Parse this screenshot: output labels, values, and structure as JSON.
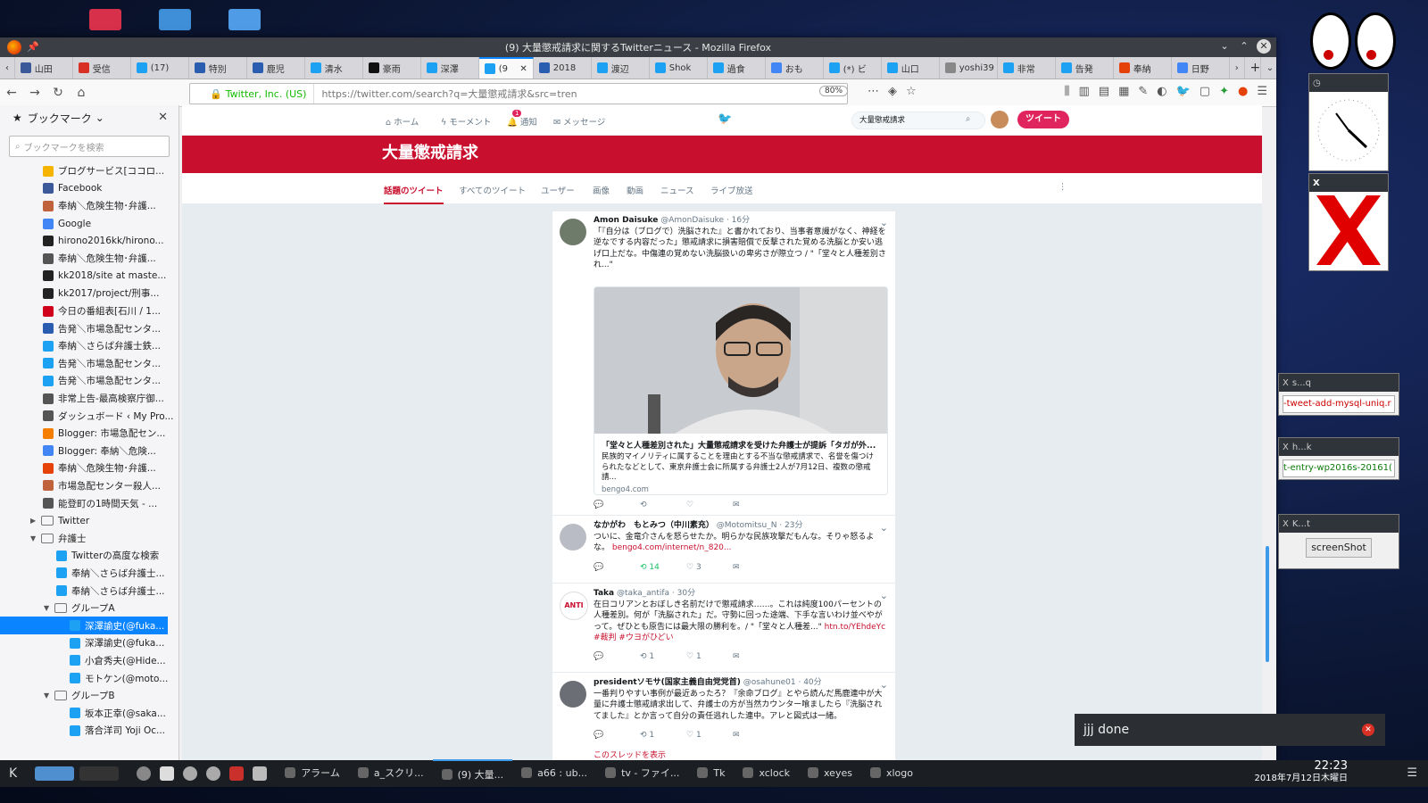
{
  "browser": {
    "window_title": "(9) 大量懲戒請求に関するTwitterニュース - Mozilla Firefox",
    "tabs": [
      {
        "label": "山田",
        "color": "#3b5998"
      },
      {
        "label": "受信",
        "color": "#d93025"
      },
      {
        "label": "(17)",
        "color": "#1da1f2"
      },
      {
        "label": "特別",
        "color": "#2a5db0"
      },
      {
        "label": "鹿児",
        "color": "#2a5db0"
      },
      {
        "label": "清水",
        "color": "#1da1f2"
      },
      {
        "label": "豪雨",
        "color": "#111111"
      },
      {
        "label": "深澤",
        "color": "#1da1f2"
      },
      {
        "label": "(9",
        "color": "#1da1f2",
        "active": true
      },
      {
        "label": "2018",
        "color": "#2a5db0"
      },
      {
        "label": "渡辺",
        "color": "#1da1f2"
      },
      {
        "label": "Shok",
        "color": "#1da1f2"
      },
      {
        "label": "過食",
        "color": "#1da1f2"
      },
      {
        "label": "おも",
        "color": "#4285f4"
      },
      {
        "label": "(*) ビ",
        "color": "#1da1f2"
      },
      {
        "label": "山口",
        "color": "#1da1f2"
      },
      {
        "label": "yoshi39",
        "color": "#888888"
      },
      {
        "label": "非常",
        "color": "#1da1f2"
      },
      {
        "label": "告発",
        "color": "#1da1f2"
      },
      {
        "label": "奉納",
        "color": "#e5420a"
      },
      {
        "label": "日野",
        "color": "#4285f4"
      }
    ],
    "url_identity": "Twitter, Inc. (US)",
    "url": "https://twitter.com/search?q=大量懲戒請求&src=tren",
    "zoom": "80%"
  },
  "sidebar": {
    "title": "ブックマーク",
    "search_placeholder": "ブックマークを検索",
    "items": [
      {
        "label": "ブログサービス[ココロ...",
        "color": "#f4b400",
        "indent": 0
      },
      {
        "label": "Facebook",
        "color": "#3b5998",
        "indent": 0
      },
      {
        "label": "奉納＼危険生物･弁護...",
        "color": "#c0623b",
        "indent": 0
      },
      {
        "label": "Google",
        "color": "#4285f4",
        "indent": 0
      },
      {
        "label": "hirono2016kk/hirono...",
        "color": "#222222",
        "indent": 0
      },
      {
        "label": "奉納＼危険生物･弁護...",
        "color": "#555555",
        "indent": 0
      },
      {
        "label": "kk2018/site at maste...",
        "color": "#222222",
        "indent": 0
      },
      {
        "label": "kk2017/project/刑事...",
        "color": "#222222",
        "indent": 0
      },
      {
        "label": "今日の番組表[石川 / 1...",
        "color": "#d0021b",
        "indent": 0
      },
      {
        "label": "告発＼市場急配センタ...",
        "color": "#2a5db0",
        "indent": 0
      },
      {
        "label": "奉納＼さらば弁護士鉄...",
        "color": "#1da1f2",
        "indent": 0
      },
      {
        "label": "告発＼市場急配センタ...",
        "color": "#1da1f2",
        "indent": 0
      },
      {
        "label": "告発＼市場急配センタ...",
        "color": "#1da1f2",
        "indent": 0
      },
      {
        "label": "非常上告-最高検察庁御...",
        "color": "#555555",
        "indent": 0
      },
      {
        "label": "ダッシュボード ‹ My Pro...",
        "color": "#555555",
        "indent": 0
      },
      {
        "label": "Blogger: 市場急配セン...",
        "color": "#f57d00",
        "indent": 0
      },
      {
        "label": "Blogger: 奉納＼危険...",
        "color": "#4285f4",
        "indent": 0
      },
      {
        "label": "奉納＼危険生物･弁護...",
        "color": "#e5420a",
        "indent": 0
      },
      {
        "label": "市場急配センター殺人...",
        "color": "#c0623b",
        "indent": 0
      },
      {
        "label": "能登町の1時間天気 - ...",
        "color": "#555555",
        "indent": 0
      },
      {
        "label": "Twitter",
        "color": "#888888",
        "indent": 0,
        "folder": true,
        "arrow": "▶"
      },
      {
        "label": "弁護士",
        "color": "#888888",
        "indent": 0,
        "folder": true,
        "arrow": "▼"
      },
      {
        "label": "Twitterの高度な検索",
        "color": "#1da1f2",
        "indent": 1
      },
      {
        "label": "奉納＼さらば弁護士...",
        "color": "#1da1f2",
        "indent": 1
      },
      {
        "label": "奉納＼さらば弁護士...",
        "color": "#1da1f2",
        "indent": 1
      },
      {
        "label": "グループA",
        "color": "#888888",
        "indent": 1,
        "folder": true,
        "arrow": "▼"
      },
      {
        "label": "深澤諭史(@fuka...",
        "color": "#1da1f2",
        "indent": 2,
        "selected": true
      },
      {
        "label": "深澤諭史(@fuka...",
        "color": "#1da1f2",
        "indent": 2
      },
      {
        "label": "小倉秀夫(@Hide...",
        "color": "#1da1f2",
        "indent": 2
      },
      {
        "label": "モトケン(@moto...",
        "color": "#1da1f2",
        "indent": 2
      },
      {
        "label": "グループB",
        "color": "#888888",
        "indent": 1,
        "folder": true,
        "arrow": "▼"
      },
      {
        "label": "坂本正幸(@saka...",
        "color": "#1da1f2",
        "indent": 2
      },
      {
        "label": "落合洋司 Yoji Oc...",
        "color": "#1da1f2",
        "indent": 2
      }
    ]
  },
  "twitter": {
    "nav": {
      "home": "ホーム",
      "moments": "モーメント",
      "notifications": "通知",
      "notifications_badge": "1",
      "messages": "メッセージ"
    },
    "search_value": "大量懲戒請求",
    "tweet_button": "ツイート",
    "banner_title": "大量懲戒請求",
    "tabs": [
      "話題のツイート",
      "すべてのツイート",
      "ユーザー",
      "画像",
      "動画",
      "ニュース",
      "ライブ放送"
    ],
    "active_tab": "話題のツイート",
    "tweets": [
      {
        "name": "Amon Daisuke",
        "handle": "@AmonDaisuke · 16分",
        "text": "「『自分は（ブログで）洗脳された』と書かれており、当事者意識がなく、神経を逆なでする内容だった」懲戒請求に損害賠償で反撃された覚める洗脳とか安い逃げ口上だな。中傷連の覚めない洗脳扱いの卑劣さが際立つ / \"「堂々と人種差別され...\"",
        "card_title": "「堂々と人種差別された」大量懲戒請求を受けた弁護士が提訴「タガが外...",
        "card_desc": "民族的マイノリティに属することを理由とする不当な懲戒請求で、名誉を傷つけられたなどとして、東京弁護士会に所属する弁護士2人が7月12日、複数の懲戒請...",
        "card_domain": "bengo4.com",
        "retweets": "",
        "likes": ""
      },
      {
        "name": "なかがわ　もとみつ（中川素充）",
        "handle": "@Motomitsu_N · 23分",
        "text": "ついに、金竜介さんを怒らせたか。明らかな民族攻撃だもんな。そりゃ怒るよな。",
        "link": "bengo4.com/internet/n_820...",
        "retweets": "14",
        "likes": "3"
      },
      {
        "name": "Taka",
        "handle": "@taka_antifa · 30分",
        "text": "在日コリアンとおぼしき名前だけで懲戒請求……。これは純度100パーセントの人種差別。何が「洗脳された」だ。守勢に回った途端、下手な言いわけ並べやがって。ぜひとも原告には最大限の勝利を。/ \"「堂々と人種差...\"",
        "link": "htn.to/YEhdeYc #裁判 #ウヨがひどい",
        "retweets": "1",
        "likes": "1"
      },
      {
        "name": "presidentソモサ(国家主義自由党党首)",
        "handle": "@osahune01 · 40分",
        "text": "一番判りやすい事例が最近あったろ？『余命ブログ』とやら読んだ馬鹿連中が大量に弁護士懲戒請求出して、弁護士の方が当然カウンター喰ましたら『洗脳されてました』とか言って自分の責任逃れした連中。アレと図式は一緒。",
        "retweets": "1",
        "likes": "1",
        "thread": "このスレッドを表示"
      }
    ]
  },
  "side_windows": {
    "xclock_title": "xclock",
    "xlogo_title": "xlogo",
    "win1_title": "s...q",
    "win1_value": "-tweet-add-mysql-uniq.r",
    "win2_title": "h...k",
    "win2_value": "t-entry-wp2016s-20161(",
    "win3_title": "K...t",
    "win3_button": "screenShot"
  },
  "notification": {
    "text": "jjj done"
  },
  "taskbar": {
    "items": [
      "アラーム",
      "a_スクリ...",
      "(9) 大量...",
      "a66 : ub...",
      "tv - ファイ...",
      "Tk",
      "xclock",
      "xeyes",
      "xlogo"
    ],
    "time": "22:23",
    "date": "2018年7月12日木曜日"
  }
}
